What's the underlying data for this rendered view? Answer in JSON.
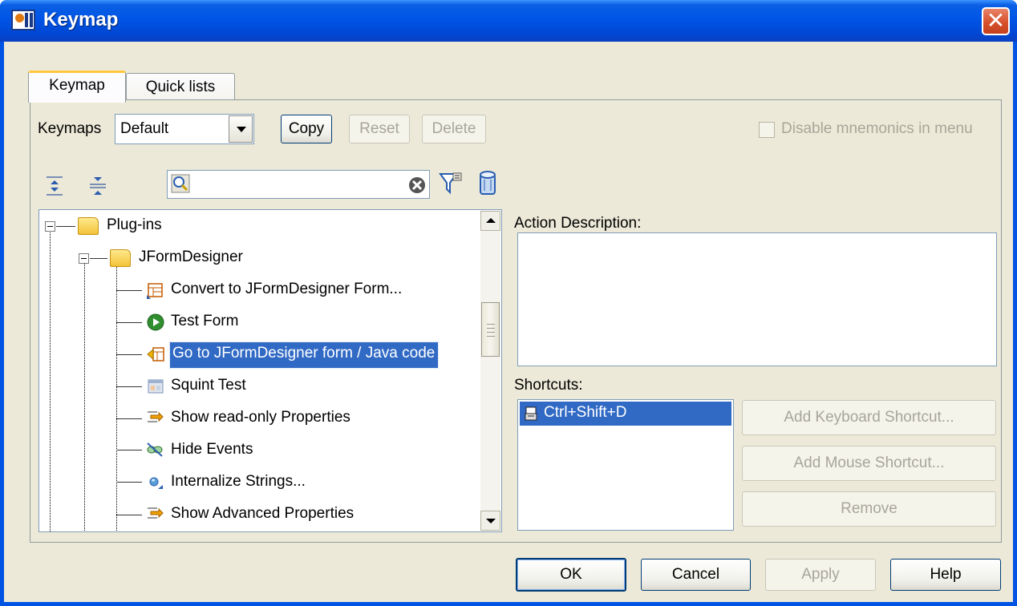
{
  "window": {
    "title": "Keymap",
    "close_glyph": "✕"
  },
  "tabs": [
    "Keymap",
    "Quick lists"
  ],
  "toolbar": {
    "keymaps_label": "Keymaps",
    "keymap_value": "Default",
    "copy_label": "Copy",
    "reset_label": "Reset",
    "delete_label": "Delete",
    "disable_mnemonics_label": "Disable mnemonics in menu"
  },
  "search": {
    "value": "",
    "placeholder": ""
  },
  "tree": {
    "items": [
      {
        "label": "Plug-ins",
        "level": 0,
        "icon": "folder-icon"
      },
      {
        "label": "JFormDesigner",
        "level": 1,
        "icon": "folder-icon"
      },
      {
        "label": "Convert to JFormDesigner Form...",
        "level": 2,
        "icon": "convert-form-icon"
      },
      {
        "label": "Test Form",
        "level": 2,
        "icon": "play-icon"
      },
      {
        "label": "Go to JFormDesigner form / Java code",
        "level": 2,
        "icon": "goto-form-icon",
        "selected": true
      },
      {
        "label": "Squint Test",
        "level": 2,
        "icon": "squint-test-icon"
      },
      {
        "label": "Show read-only Properties",
        "level": 2,
        "icon": "properties-icon"
      },
      {
        "label": "Hide Events",
        "level": 2,
        "icon": "hide-events-icon"
      },
      {
        "label": "Internalize Strings...",
        "level": 2,
        "icon": "globe-icon"
      },
      {
        "label": "Show Advanced Properties",
        "level": 2,
        "icon": "advanced-properties-icon"
      }
    ]
  },
  "action_description": {
    "label": "Action Description:",
    "value": ""
  },
  "shortcuts": {
    "label": "Shortcuts:",
    "items": [
      "Ctrl+Shift+D"
    ],
    "add_keyboard_label": "Add Keyboard Shortcut...",
    "add_mouse_label": "Add Mouse Shortcut...",
    "remove_label": "Remove"
  },
  "footer": {
    "ok_label": "OK",
    "cancel_label": "Cancel",
    "apply_label": "Apply",
    "help_label": "Help"
  },
  "colors": {
    "title_bar": "#0055e6",
    "selection": "#316ac5",
    "dialog_bg": "#ece9d8",
    "close_button": "#d8512c"
  }
}
